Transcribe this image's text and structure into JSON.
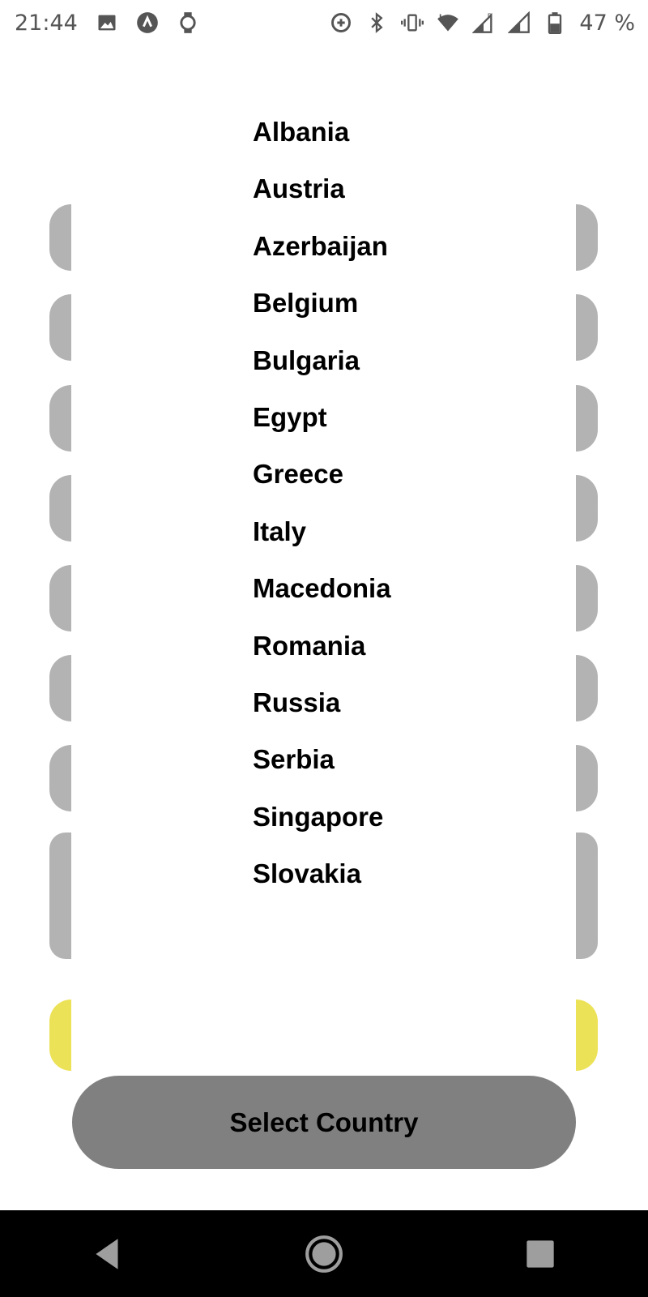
{
  "status_bar": {
    "time": "21:44",
    "left_icons": [
      "image-icon",
      "app-logo-icon",
      "watch-icon"
    ],
    "right_icons": [
      "data-saver-icon",
      "bluetooth-icon",
      "vibrate-icon",
      "wifi-icon",
      "signal-roaming-icon",
      "signal-icon",
      "battery-icon"
    ],
    "battery_percent": "47 %",
    "roaming_indicator": "R"
  },
  "country_list": {
    "items": [
      {
        "label": "Albania"
      },
      {
        "label": "Austria"
      },
      {
        "label": "Azerbaijan"
      },
      {
        "label": "Belgium"
      },
      {
        "label": "Bulgaria"
      },
      {
        "label": "Egypt"
      },
      {
        "label": "Greece"
      },
      {
        "label": "Italy"
      },
      {
        "label": "Macedonia"
      },
      {
        "label": "Romania"
      },
      {
        "label": "Russia"
      },
      {
        "label": "Serbia"
      },
      {
        "label": "Singapore"
      },
      {
        "label": "Slovakia"
      }
    ]
  },
  "select_button": {
    "label": "Select Country"
  },
  "colors": {
    "side_decor": "#b3b3b3",
    "side_accent": "#ece257",
    "button_bg": "#808080",
    "nav_bg": "#000000"
  },
  "nav_bar": {
    "buttons": [
      "back-icon",
      "home-icon",
      "recents-icon"
    ]
  }
}
